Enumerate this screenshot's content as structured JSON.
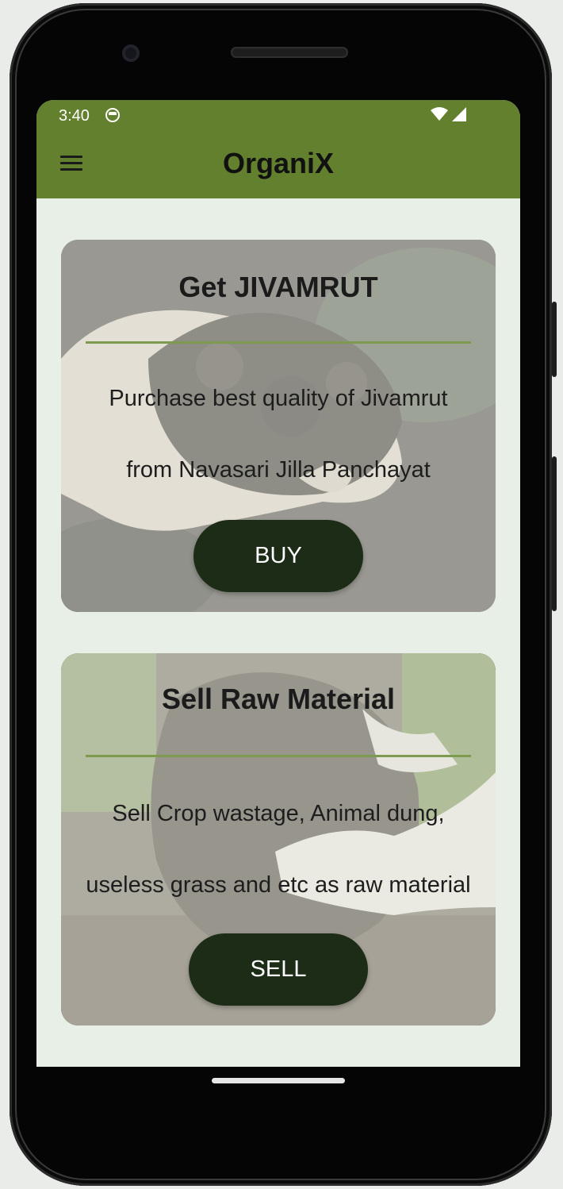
{
  "status_bar": {
    "time": "3:40",
    "icons": [
      "app-notification-icon",
      "wifi-icon",
      "cell-signal-icon"
    ]
  },
  "app_bar": {
    "title": "OrganiX",
    "menu_icon": "hamburger-menu-icon",
    "color": "#62802e"
  },
  "cards": [
    {
      "title": "Get JIVAMRUT",
      "line1": "Purchase best quality of Jivamrut",
      "line2": "from Navasari Jilla Panchayat",
      "button_label": "BUY",
      "image": "hands holding compost soil"
    },
    {
      "title": "Sell Raw Material",
      "line1": "Sell Crop wastage, Animal dung,",
      "line2": "useless grass and etc as raw material",
      "button_label": "SELL",
      "image": "gloved hands holding crop waste"
    }
  ],
  "colors": {
    "background": "#e8efe6",
    "button": "#1c2c16",
    "divider": "#7e9a4f"
  }
}
